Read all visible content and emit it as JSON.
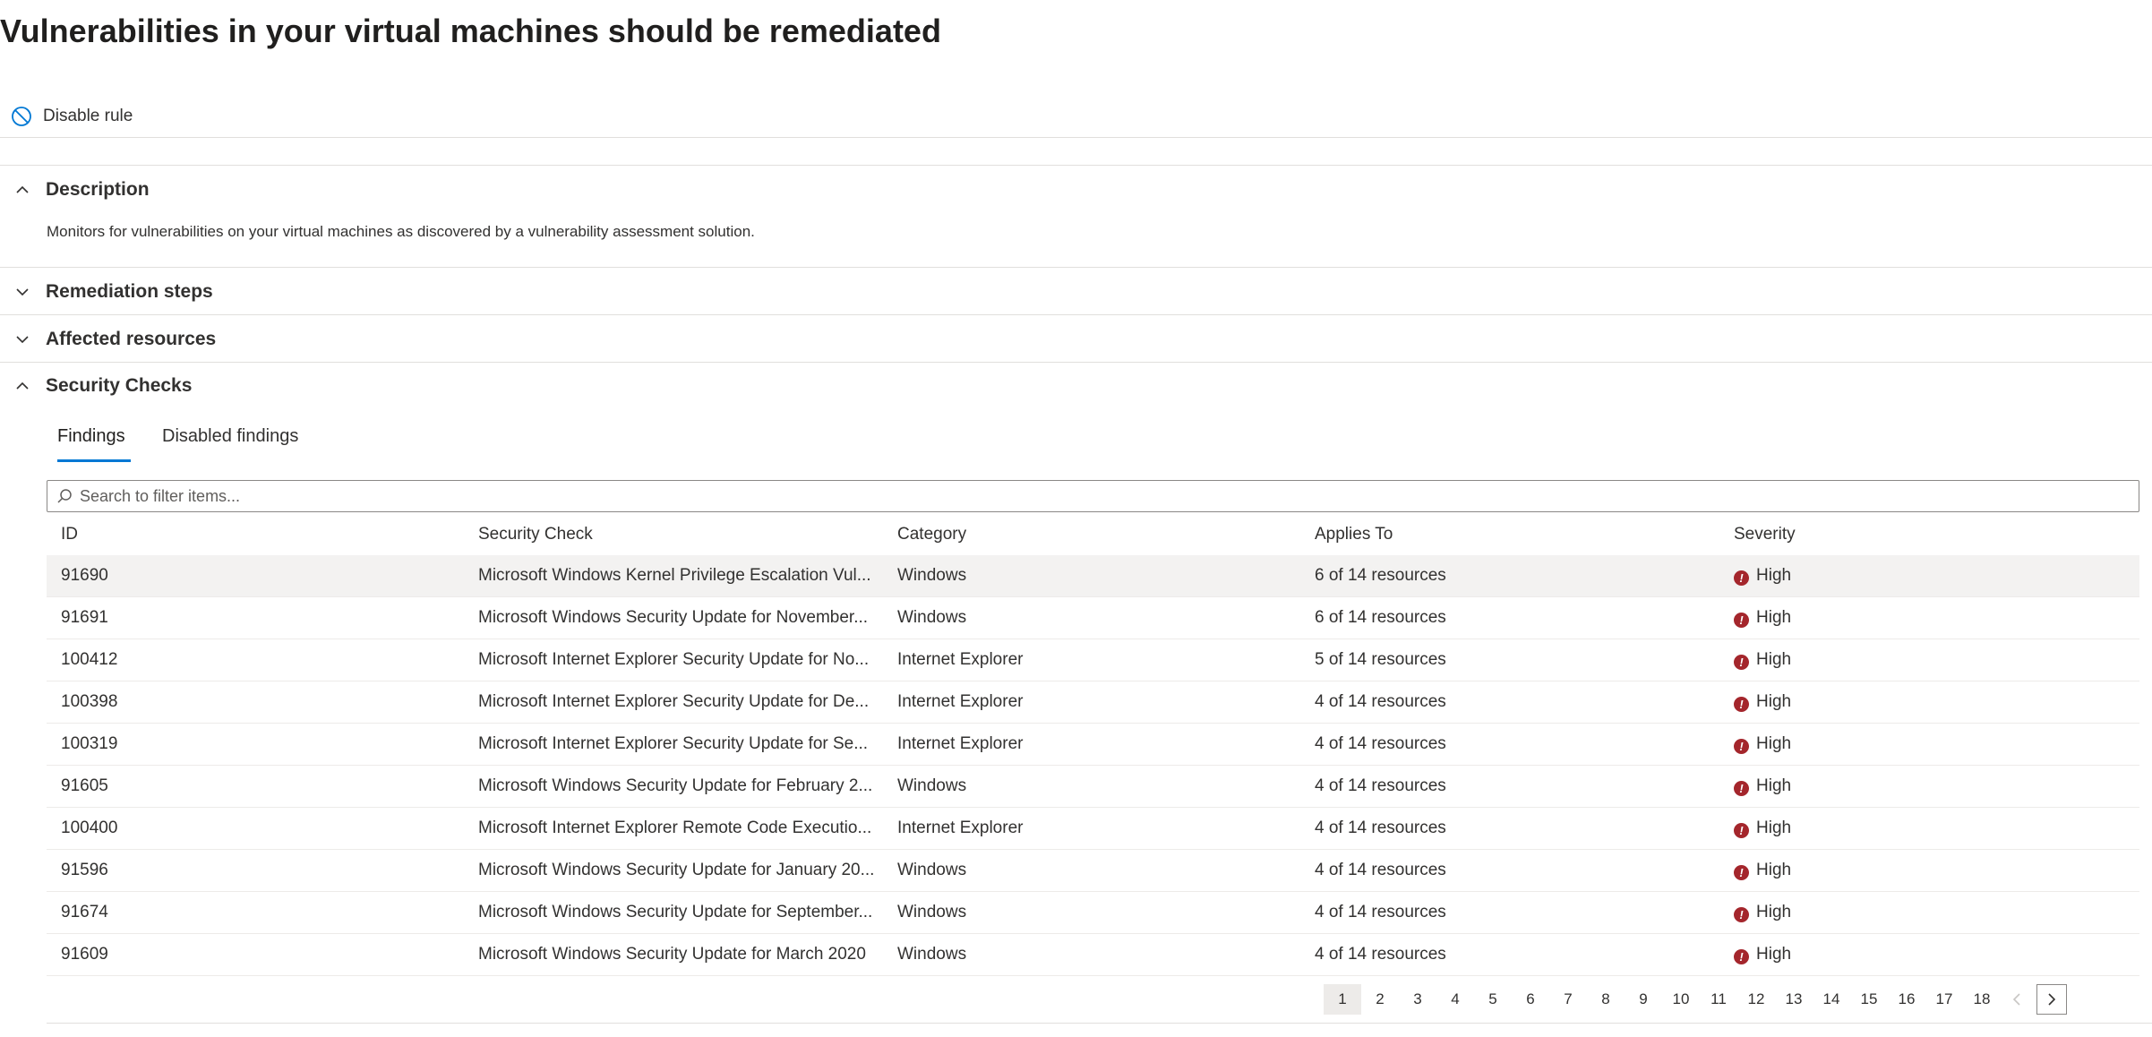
{
  "page": {
    "title": "Vulnerabilities in your virtual machines should be remediated"
  },
  "toolbar": {
    "disable_label": "Disable rule"
  },
  "sections": {
    "description": {
      "title": "Description",
      "expanded": true,
      "text": "Monitors for vulnerabilities on your virtual machines as discovered by a vulnerability assessment solution."
    },
    "remediation": {
      "title": "Remediation steps",
      "expanded": false
    },
    "affected": {
      "title": "Affected resources",
      "expanded": false
    },
    "security_checks": {
      "title": "Security Checks",
      "expanded": true
    }
  },
  "tabs": {
    "findings": "Findings",
    "disabled": "Disabled findings",
    "active": "findings"
  },
  "search": {
    "placeholder": "Search to filter items..."
  },
  "table": {
    "columns": {
      "id": "ID",
      "check": "Security Check",
      "category": "Category",
      "applies": "Applies To",
      "severity": "Severity"
    },
    "rows": [
      {
        "id": "91690",
        "check": "Microsoft Windows Kernel Privilege Escalation Vul...",
        "category": "Windows",
        "applies": "6 of 14 resources",
        "severity": "High"
      },
      {
        "id": "91691",
        "check": "Microsoft Windows Security Update for November...",
        "category": "Windows",
        "applies": "6 of 14 resources",
        "severity": "High"
      },
      {
        "id": "100412",
        "check": "Microsoft Internet Explorer Security Update for No...",
        "category": "Internet Explorer",
        "applies": "5 of 14 resources",
        "severity": "High"
      },
      {
        "id": "100398",
        "check": "Microsoft Internet Explorer Security Update for De...",
        "category": "Internet Explorer",
        "applies": "4 of 14 resources",
        "severity": "High"
      },
      {
        "id": "100319",
        "check": "Microsoft Internet Explorer Security Update for Se...",
        "category": "Internet Explorer",
        "applies": "4 of 14 resources",
        "severity": "High"
      },
      {
        "id": "91605",
        "check": "Microsoft Windows Security Update for February 2...",
        "category": "Windows",
        "applies": "4 of 14 resources",
        "severity": "High"
      },
      {
        "id": "100400",
        "check": "Microsoft Internet Explorer Remote Code Executio...",
        "category": "Internet Explorer",
        "applies": "4 of 14 resources",
        "severity": "High"
      },
      {
        "id": "91596",
        "check": "Microsoft Windows Security Update for January 20...",
        "category": "Windows",
        "applies": "4 of 14 resources",
        "severity": "High"
      },
      {
        "id": "91674",
        "check": "Microsoft Windows Security Update for September...",
        "category": "Windows",
        "applies": "4 of 14 resources",
        "severity": "High"
      },
      {
        "id": "91609",
        "check": "Microsoft Windows Security Update for March 2020",
        "category": "Windows",
        "applies": "4 of 14 resources",
        "severity": "High"
      }
    ],
    "selected_row": 0
  },
  "pagination": {
    "pages": [
      "1",
      "2",
      "3",
      "4",
      "5",
      "6",
      "7",
      "8",
      "9",
      "10",
      "11",
      "12",
      "13",
      "14",
      "15",
      "16",
      "17",
      "18"
    ],
    "current": "1"
  },
  "colors": {
    "accent": "#0078d4",
    "severity_high": "#a4262c",
    "text": "#323130"
  },
  "icons": {
    "disable": "block-icon",
    "search": "search-icon",
    "severity": "error-badge-icon"
  }
}
